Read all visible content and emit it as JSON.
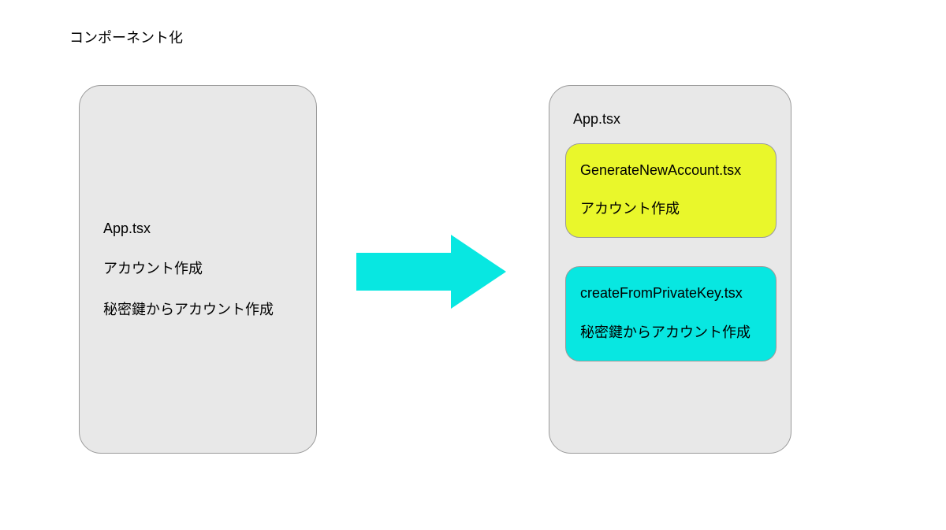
{
  "title": "コンポーネント化",
  "left": {
    "title": "App.tsx",
    "lines": [
      "アカウント作成",
      "秘密鍵からアカウント作成"
    ]
  },
  "right": {
    "title": "App.tsx",
    "components": [
      {
        "name": "GenerateNewAccount.tsx",
        "desc": "アカウント作成"
      },
      {
        "name": "createFromPrivateKey.tsx",
        "desc": "秘密鍵からアカウント作成"
      }
    ]
  },
  "arrow": {
    "color": "#08e7e1"
  }
}
